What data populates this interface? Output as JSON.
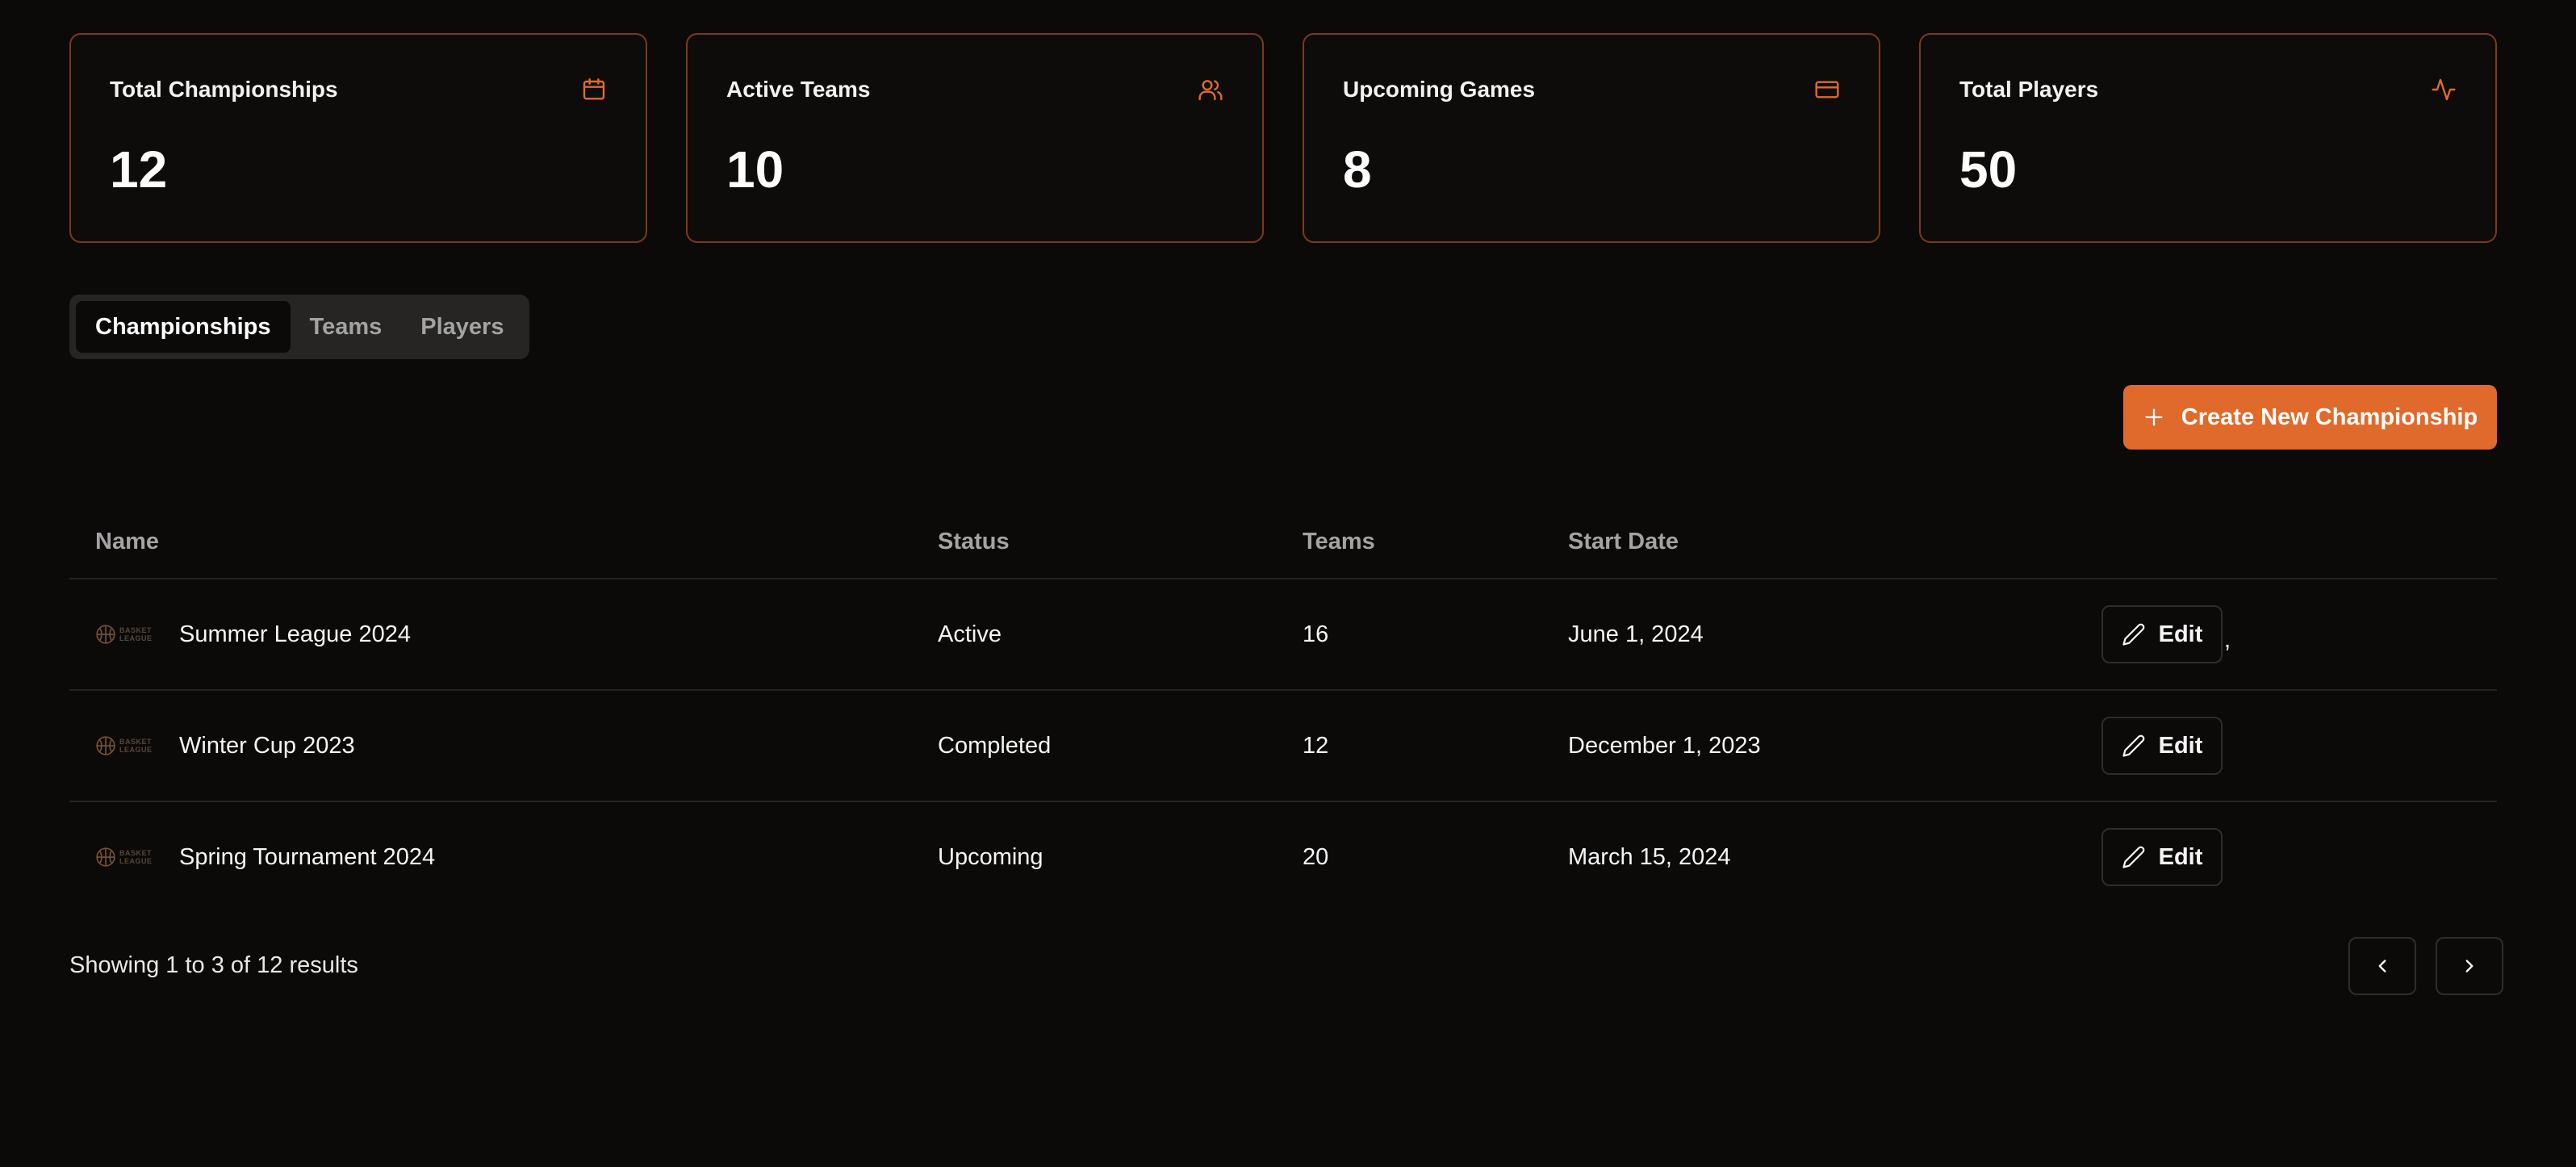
{
  "stats": [
    {
      "title": "Total Championships",
      "value": "12",
      "icon": "calendar-icon"
    },
    {
      "title": "Active Teams",
      "value": "10",
      "icon": "users-icon"
    },
    {
      "title": "Upcoming Games",
      "value": "8",
      "icon": "credit-card-icon"
    },
    {
      "title": "Total Players",
      "value": "50",
      "icon": "activity-icon"
    }
  ],
  "tabs": [
    {
      "label": "Championships",
      "active": true
    },
    {
      "label": "Teams",
      "active": false
    },
    {
      "label": "Players",
      "active": false
    }
  ],
  "create_button_label": "Create New Championship",
  "table": {
    "headers": {
      "name": "Name",
      "status": "Status",
      "teams": "Teams",
      "start_date": "Start Date"
    },
    "rows": [
      {
        "name": "Summer League 2024",
        "status": "Active",
        "teams": "16",
        "start_date": "June 1, 2024",
        "action": "Edit"
      },
      {
        "name": "Winter Cup 2023",
        "status": "Completed",
        "teams": "12",
        "start_date": "December 1, 2023",
        "action": "Edit"
      },
      {
        "name": "Spring Tournament 2024",
        "status": "Upcoming",
        "teams": "20",
        "start_date": "March 15, 2024",
        "action": "Edit"
      }
    ],
    "stray_char": ",",
    "logo_text_line1": "BASKET",
    "logo_text_line2": "LEAGUE"
  },
  "footer": {
    "showing_text": "Showing 1 to 3 of 12 results"
  },
  "colors": {
    "accent": "#e06a2c",
    "card_border": "#7a3a1c",
    "background": "#0b0a09"
  }
}
